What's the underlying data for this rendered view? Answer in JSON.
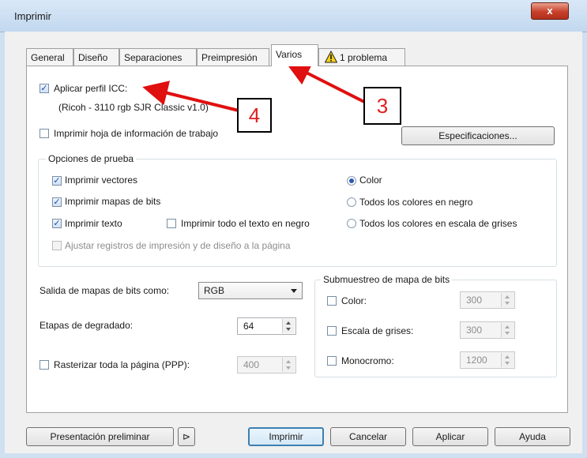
{
  "window": {
    "title": "Imprimir",
    "close_label": "x"
  },
  "tabs": [
    {
      "label": "General"
    },
    {
      "label": "Diseño"
    },
    {
      "label": "Separaciones"
    },
    {
      "label": "Preimpresión"
    },
    {
      "label": "Varios",
      "active": true
    },
    {
      "label": "1 problema",
      "icon": "warning-icon"
    }
  ],
  "varios": {
    "icc_checkbox": "Aplicar perfil ICC:",
    "icc_profile": "(Ricoh - 3110 rgb SJR Classic v1.0)",
    "info_sheet_checkbox": "Imprimir hoja de información de trabajo",
    "specs_button": "Especificaciones...",
    "proof_group": {
      "legend": "Opciones de prueba",
      "print_vectors": "Imprimir vectores",
      "print_bitmaps": "Imprimir mapas de bits",
      "print_text": "Imprimir texto",
      "print_all_text_black": "Imprimir todo el texto en negro",
      "adjust_registers": "Ajustar registros de impresión y de diseño a la página",
      "radio_color": "Color",
      "radio_all_black": "Todos los colores en negro",
      "radio_grayscale": "Todos los colores en escala de grises"
    },
    "bitmap_output_label": "Salida de mapas de bits como:",
    "bitmap_output_value": "RGB",
    "gradient_steps_label": "Etapas de degradado:",
    "gradient_steps_value": "64",
    "rasterize_label": "Rasterizar toda la página (PPP):",
    "rasterize_value": "400",
    "downsample_group": {
      "legend": "Submuestreo de mapa de bits",
      "color_label": "Color:",
      "color_value": "300",
      "grayscale_label": "Escala de grises:",
      "grayscale_value": "300",
      "mono_label": "Monocromo:",
      "mono_value": "1200"
    }
  },
  "footer": {
    "preview_button": "Presentación preliminar",
    "expand_glyph": "⊳",
    "print_button": "Imprimir",
    "cancel_button": "Cancelar",
    "apply_button": "Aplicar",
    "help_button": "Ayuda"
  },
  "annotations": {
    "label_3": "3",
    "label_4": "4",
    "arrow_color": "#e01010"
  }
}
